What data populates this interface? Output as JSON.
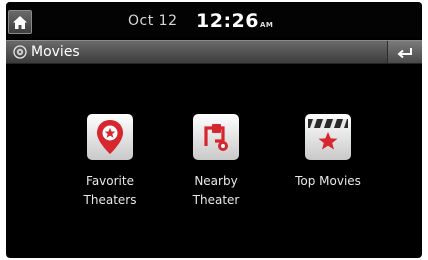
{
  "status": {
    "date": "Oct 12",
    "time": "12:26",
    "ampm": "AM"
  },
  "title_bar": {
    "title": "Movies"
  },
  "menu": [
    {
      "line1": "Favorite",
      "line2": "Theaters",
      "icon": "map-pin-star-icon"
    },
    {
      "line1": "Nearby",
      "line2": "Theater",
      "icon": "route-pin-icon"
    },
    {
      "line1": "Top Movies",
      "line2": "",
      "icon": "clapperboard-star-icon"
    }
  ],
  "colors": {
    "accent": "#d8262f",
    "background": "#000000",
    "titlebar": "#555555"
  }
}
